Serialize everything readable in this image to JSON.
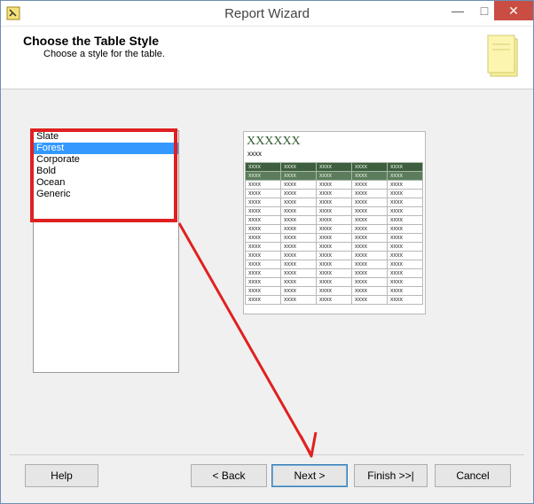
{
  "window": {
    "title": "Report Wizard"
  },
  "header": {
    "title": "Choose the Table Style",
    "subtitle": "Choose a style for the table."
  },
  "styles": {
    "items": [
      "Slate",
      "Forest",
      "Corporate",
      "Bold",
      "Ocean",
      "Generic"
    ],
    "selected": "Forest"
  },
  "preview": {
    "title": "XXXXXX",
    "subtitle": "xxxx",
    "cell": "xxxx",
    "header_color": "#3e5f3e"
  },
  "buttons": {
    "help": "Help",
    "back": "< Back",
    "next": "Next >",
    "finish": "Finish >>|",
    "cancel": "Cancel"
  },
  "annotation": {
    "color": "#e02020"
  }
}
